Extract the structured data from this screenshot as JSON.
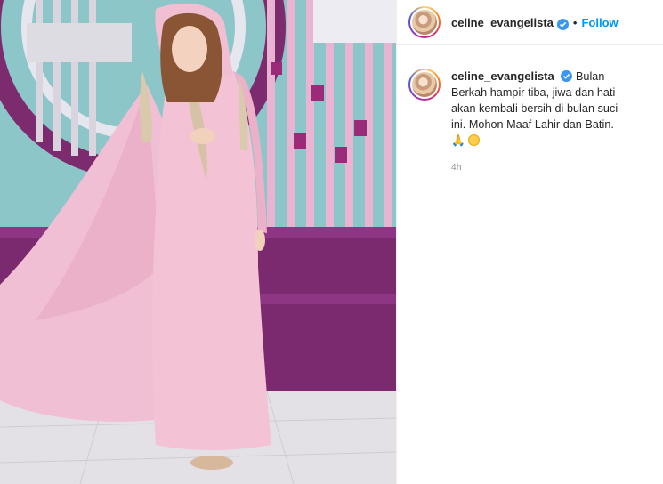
{
  "header": {
    "username": "celine_evangelista",
    "separator": "•",
    "follow_label": "Follow"
  },
  "caption": {
    "username": "celine_evangelista",
    "text": "Bulan Berkah hampir tiba, jiwa dan hati akan kembali bersih di bulan suci ini. Mohon Maaf Lahir dan Batin.",
    "emojis": [
      "pray-emoji",
      "smile-emoji"
    ],
    "timestamp": "4h"
  },
  "colors": {
    "accent": "#0095f6",
    "verified": "#3897f0",
    "dress": "#f0b8cc",
    "backdrop_teal": "#86c3c6",
    "backdrop_purple": "#7a2a6e"
  }
}
